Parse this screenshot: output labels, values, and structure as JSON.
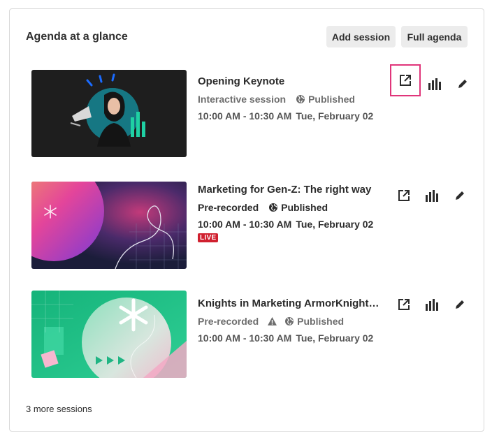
{
  "header": {
    "title": "Agenda at a glance",
    "add_session_label": "Add session",
    "full_agenda_label": "Full agenda"
  },
  "sessions": [
    {
      "title": "Opening Keynote",
      "type": "Interactive session",
      "status": "Published",
      "time": "10:00 AM - 10:30 AM",
      "date": "Tue, February 02",
      "live": ""
    },
    {
      "title": "Marketing for Gen-Z: The right way",
      "type": "Pre-recorded",
      "status": "Published",
      "time": "10:00 AM - 10:30 AM",
      "date": "Tue, February 02",
      "live": "LIVE"
    },
    {
      "title": "Knights in Marketing ArmorKnights in Marketing Armor",
      "type": "Pre-recorded",
      "status": "Published",
      "time": "10:00 AM - 10:30 AM",
      "date": "Tue, February 02",
      "live": ""
    }
  ],
  "footer": {
    "more_label": "3 more sessions"
  },
  "icons": {
    "open": "external-link-icon",
    "stats": "bar-chart-icon",
    "edit": "pencil-icon",
    "globe": "globe-icon",
    "warning": "warning-icon"
  },
  "colors": {
    "highlight": "#e0357a",
    "live": "#d0202f",
    "button_bg": "#ececec"
  }
}
